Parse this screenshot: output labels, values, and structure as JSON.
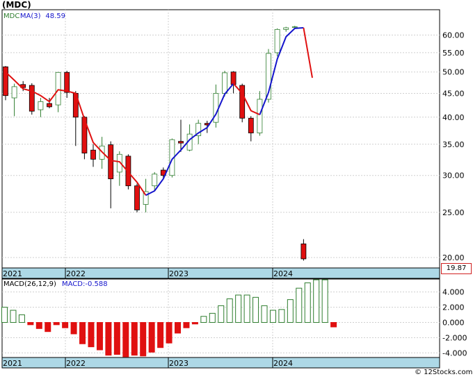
{
  "ticker_title": "(MDC)",
  "last_price": "19.87",
  "watermark": "© 12Stocks.com",
  "colors": {
    "up_candle": "#2e7d2e",
    "down_candle": "#e01010",
    "ma_up": "#1515cc",
    "ma_down": "#e01010",
    "macd_up": "#2e7d2e",
    "macd_down": "#e01010",
    "axis_band": "#add8e6"
  },
  "chart_data": [
    {
      "type": "candlestick",
      "title": "(MDC)",
      "legend": [
        {
          "text": "MDC",
          "color": "#2e7d2e"
        },
        {
          "text": "MA(3)",
          "color": "#1515cc"
        },
        {
          "text": "48.59",
          "color": "#1515cc"
        }
      ],
      "x_tick_labels": [
        "2021",
        "2022",
        "2023",
        "2024"
      ],
      "y_tick_labels": [
        "60.00",
        "55.00",
        "50.00",
        "45.00",
        "40.00",
        "35.00",
        "30.00",
        "25.00",
        "20.00"
      ],
      "y_scale": "log",
      "ylim": [
        19,
        68
      ],
      "grid": true,
      "candles": [
        {
          "o": 51.3,
          "h": 51.5,
          "l": 43.5,
          "c": 44.5
        },
        {
          "o": 44.0,
          "h": 47.2,
          "l": 40.2,
          "c": 46.5
        },
        {
          "o": 47.0,
          "h": 47.8,
          "l": 45.5,
          "c": 46.3
        },
        {
          "o": 46.8,
          "h": 47.3,
          "l": 40.5,
          "c": 41.2
        },
        {
          "o": 41.5,
          "h": 44.0,
          "l": 40.0,
          "c": 43.2
        },
        {
          "o": 42.8,
          "h": 44.0,
          "l": 41.8,
          "c": 42.1
        },
        {
          "o": 42.5,
          "h": 50.0,
          "l": 41.0,
          "c": 49.9
        },
        {
          "o": 49.9,
          "h": 50.3,
          "l": 44.0,
          "c": 45.2
        },
        {
          "o": 45.0,
          "h": 45.5,
          "l": 34.7,
          "c": 40.0
        },
        {
          "o": 40.0,
          "h": 40.2,
          "l": 32.5,
          "c": 33.5
        },
        {
          "o": 34.0,
          "h": 35.0,
          "l": 31.3,
          "c": 32.5
        },
        {
          "o": 32.5,
          "h": 36.3,
          "l": 31.0,
          "c": 34.7
        },
        {
          "o": 34.9,
          "h": 35.5,
          "l": 25.5,
          "c": 29.5
        },
        {
          "o": 30.5,
          "h": 33.8,
          "l": 28.5,
          "c": 33.3
        },
        {
          "o": 33.0,
          "h": 33.3,
          "l": 28.0,
          "c": 28.5
        },
        {
          "o": 28.5,
          "h": 28.8,
          "l": 25.0,
          "c": 25.3
        },
        {
          "o": 26.0,
          "h": 29.5,
          "l": 25.0,
          "c": 27.7
        },
        {
          "o": 28.5,
          "h": 30.5,
          "l": 27.8,
          "c": 30.2
        },
        {
          "o": 30.8,
          "h": 31.2,
          "l": 29.5,
          "c": 30.0
        },
        {
          "o": 30.0,
          "h": 36.0,
          "l": 29.7,
          "c": 35.8
        },
        {
          "o": 35.5,
          "h": 39.5,
          "l": 33.7,
          "c": 35.2
        },
        {
          "o": 34.0,
          "h": 38.6,
          "l": 33.8,
          "c": 36.8
        },
        {
          "o": 36.5,
          "h": 39.5,
          "l": 35.0,
          "c": 38.8
        },
        {
          "o": 38.8,
          "h": 39.3,
          "l": 37.0,
          "c": 38.5
        },
        {
          "o": 39.0,
          "h": 47.0,
          "l": 38.0,
          "c": 45.0
        },
        {
          "o": 45.0,
          "h": 50.3,
          "l": 44.3,
          "c": 49.8
        },
        {
          "o": 50.0,
          "h": 50.2,
          "l": 45.0,
          "c": 47.0
        },
        {
          "o": 46.8,
          "h": 47.2,
          "l": 39.0,
          "c": 39.8
        },
        {
          "o": 39.8,
          "h": 40.2,
          "l": 35.5,
          "c": 37.0
        },
        {
          "o": 37.0,
          "h": 45.5,
          "l": 36.5,
          "c": 43.7
        },
        {
          "o": 43.7,
          "h": 56.0,
          "l": 43.0,
          "c": 54.8
        },
        {
          "o": 55.0,
          "h": 62.0,
          "l": 54.0,
          "c": 61.7
        },
        {
          "o": 61.7,
          "h": 62.5,
          "l": 61.0,
          "c": 62.2
        },
        {
          "o": 62.4,
          "h": 62.8,
          "l": 61.8,
          "c": 62.5
        },
        {
          "o": 21.4,
          "h": 21.9,
          "l": 19.7,
          "c": 19.87
        }
      ],
      "ma": [
        50.0,
        48.0,
        46.0,
        45.5,
        44.5,
        43.2,
        45.8,
        45.5,
        45.0,
        39.6,
        35.3,
        33.7,
        32.3,
        32.1,
        30.5,
        29.0,
        27.2,
        27.8,
        29.5,
        32.5,
        34.0,
        35.8,
        37.0,
        38.0,
        40.6,
        44.8,
        47.2,
        45.0,
        41.3,
        40.5,
        45.2,
        53.3,
        59.5,
        62.0,
        62.2,
        48.59
      ],
      "ma_segments": [
        {
          "from": 0,
          "to": 16,
          "color": "#e01010"
        },
        {
          "from": 16,
          "to": 26,
          "color": "#1515cc"
        },
        {
          "from": 26,
          "to": 29,
          "color": "#e01010"
        },
        {
          "from": 29,
          "to": 34,
          "color": "#1515cc"
        },
        {
          "from": 34,
          "to": 35,
          "color": "#e01010"
        }
      ]
    },
    {
      "type": "bar",
      "title": "MACD(26,12,9)",
      "legend": [
        {
          "text": "MACD(26,12,9)",
          "color": "#000000"
        },
        {
          "text": "MACD:-0.588",
          "color": "#1515cc"
        }
      ],
      "x_tick_labels": [
        "2021",
        "2022",
        "2023",
        "2024"
      ],
      "y_tick_labels": [
        "4.000",
        "2.000",
        "0.000",
        "-2.000",
        "-4.000"
      ],
      "ylim": [
        -4.6,
        5.7
      ],
      "grid": true,
      "values": [
        2.0,
        1.6,
        1.0,
        -0.3,
        -0.8,
        -1.2,
        -0.3,
        -0.7,
        -1.5,
        -2.8,
        -3.2,
        -3.6,
        -4.3,
        -4.2,
        -4.5,
        -4.3,
        -4.4,
        -3.9,
        -3.3,
        -2.7,
        -1.4,
        -0.7,
        -0.2,
        0.8,
        1.2,
        2.2,
        3.1,
        3.6,
        3.6,
        3.3,
        2.2,
        1.6,
        1.7,
        3.0,
        4.5,
        5.2,
        5.6,
        5.6,
        -0.588
      ]
    }
  ]
}
